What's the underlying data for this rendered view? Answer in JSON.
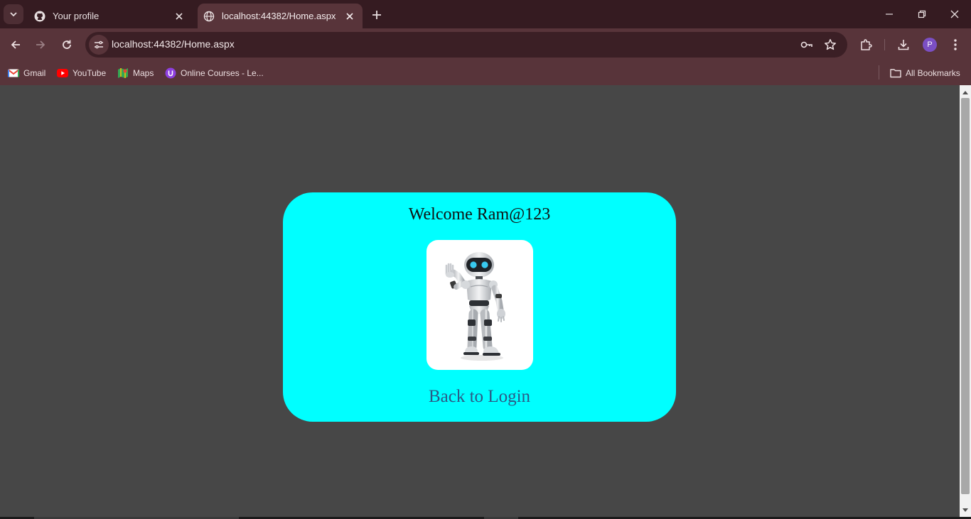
{
  "browser": {
    "tabs": [
      {
        "title": "Your profile",
        "favicon": "github-icon",
        "active": false
      },
      {
        "title": "localhost:44382/Home.aspx",
        "favicon": "globe-icon",
        "active": true
      }
    ],
    "address_bar": {
      "url": "localhost:44382/Home.aspx"
    },
    "avatar_initial": "P",
    "bookmarks": [
      {
        "label": "Gmail",
        "icon": "gmail-icon"
      },
      {
        "label": "YouTube",
        "icon": "youtube-icon"
      },
      {
        "label": "Maps",
        "icon": "maps-icon"
      },
      {
        "label": "Online Courses - Le...",
        "icon": "courses-icon"
      }
    ],
    "all_bookmarks_label": "All Bookmarks"
  },
  "page": {
    "background_color": "#474747",
    "card_color": "#00ffff",
    "welcome_text": "Welcome Ram@123",
    "back_link_text": "Back to Login",
    "link_color": "#2b5a86"
  }
}
